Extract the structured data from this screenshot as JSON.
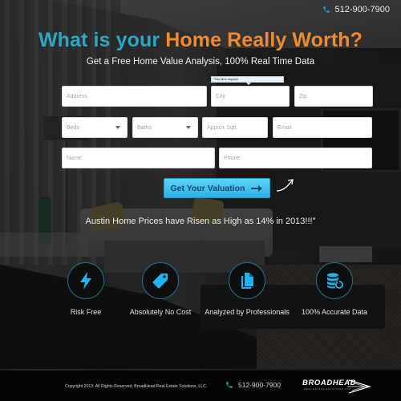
{
  "header": {
    "phone": "512-900-7900",
    "phone_icon": "phone-icon"
  },
  "hero": {
    "headline_part1": "What is your ",
    "headline_part2": "Home Really Worth?",
    "subheadline": "Get a Free Home Value Analysis, 100% Real Time Data",
    "colors": {
      "headline_blue": "#2ba7c3",
      "headline_orange": "#f08a2f"
    }
  },
  "form": {
    "validation_tooltip": "*This fild is required",
    "fields": {
      "address": {
        "placeholder": "Address",
        "value": ""
      },
      "city": {
        "placeholder": "City",
        "value": ""
      },
      "zip": {
        "placeholder": "Zip",
        "value": ""
      },
      "beds": {
        "selected": "Beds"
      },
      "baths": {
        "selected": "Baths"
      },
      "sqft": {
        "placeholder": "Approx Sqft",
        "value": ""
      },
      "email": {
        "placeholder": "Email",
        "value": ""
      },
      "name": {
        "placeholder": "Name",
        "value": ""
      },
      "phone": {
        "placeholder": "Phone",
        "value": ""
      }
    },
    "submit_label": "Get Your Valuation",
    "submit_icon": "arrow-right-icon",
    "submit_color": "#29b2e7"
  },
  "stat_text": "Austin Home Prices have Risen as High as 14% in 2013!!!\"",
  "features": [
    {
      "icon": "lightning-icon",
      "label": "Risk Free"
    },
    {
      "icon": "price-tag-icon",
      "label": "Absolutely No Cost"
    },
    {
      "icon": "documents-icon",
      "label": "Analyzed by Professionals"
    },
    {
      "icon": "database-refresh-icon",
      "label": "100% Accurate Data"
    }
  ],
  "footer": {
    "copyright": "Copyright 2013. All Rights Reserved. BroadHead Real Estate Solutions, LLC.",
    "phone": "512-900-7900",
    "logo_text": "BROADHEAD",
    "logo_tagline": "REAL ESTATE SOLUTIONS LLC"
  },
  "accent_color": "#1fa8dc"
}
